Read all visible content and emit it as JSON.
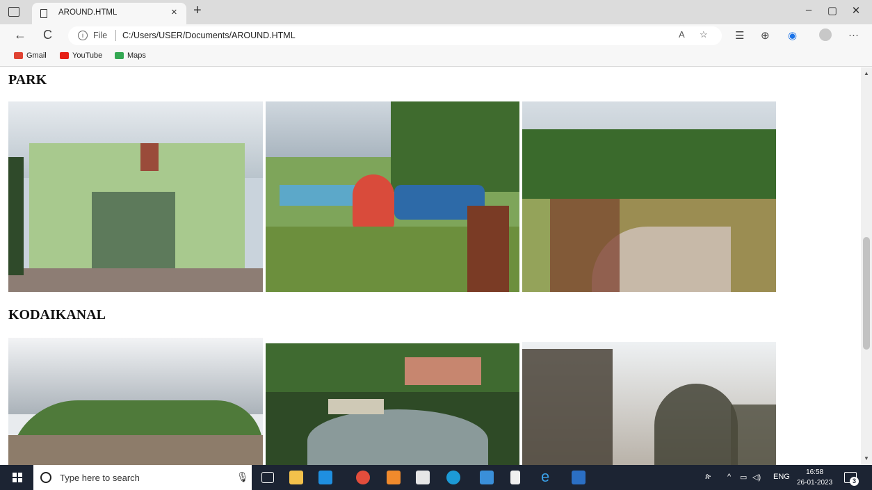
{
  "browser": {
    "tab_title": "AROUND.HTML",
    "tab_close": "×",
    "new_tab": "+",
    "win_minimize": "–",
    "win_restore": "▢",
    "win_close": "✕",
    "back": "←",
    "refresh": "C",
    "info": "i",
    "file_label": "File",
    "url": "C:/Users/USER/Documents/AROUND.HTML",
    "more": "···"
  },
  "bookmarks": [
    {
      "label": "Gmail",
      "color": "#e04333"
    },
    {
      "label": "YouTube",
      "color": "#e62117"
    },
    {
      "label": "Maps",
      "color": "#34a853"
    }
  ],
  "page": {
    "sections": [
      {
        "title": "PARK"
      },
      {
        "title": "KODAIKANAL"
      }
    ]
  },
  "taskbar": {
    "search_placeholder": "Type here to search",
    "lang": "ENG",
    "time": "16:58",
    "date": "26-01-2023",
    "notifications": "3"
  }
}
